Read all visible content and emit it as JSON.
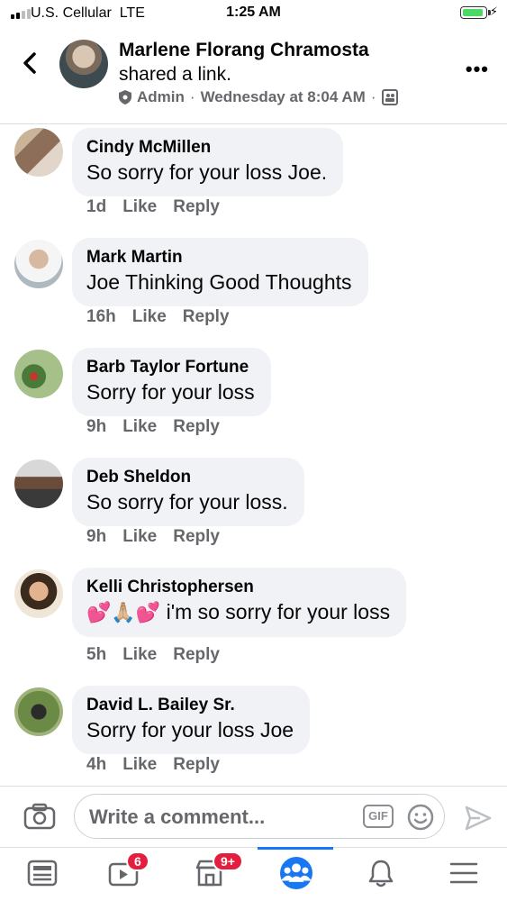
{
  "status_bar": {
    "carrier": "U.S. Cellular",
    "network": "LTE",
    "time": "1:25 AM"
  },
  "header": {
    "poster_name": "Marlene Florang Chramosta",
    "action": "shared a link.",
    "role": "Admin",
    "separator": "·",
    "timestamp": "Wednesday at 8:04 AM"
  },
  "comments": [
    {
      "name": "Cindy McMillen",
      "text": "So sorry for your loss Joe.",
      "time": "1d",
      "like": "Like",
      "reply": "Reply"
    },
    {
      "name": "Mark Martin",
      "text": "Joe Thinking Good Thoughts",
      "time": "16h",
      "like": "Like",
      "reply": "Reply"
    },
    {
      "name": "Barb Taylor Fortune",
      "text": "Sorry for your loss",
      "time": "9h",
      "like": "Like",
      "reply": "Reply"
    },
    {
      "name": "Deb Sheldon",
      "text": "So sorry for your loss.",
      "time": "9h",
      "like": "Like",
      "reply": "Reply"
    },
    {
      "name": "Kelli Christophersen",
      "emoji": "💕🙏🏼💕",
      "text": "i'm so sorry for your loss",
      "time": "5h",
      "like": "Like",
      "reply": "Reply"
    },
    {
      "name": "David L. Bailey Sr.",
      "text": "Sorry for your loss Joe",
      "time": "4h",
      "like": "Like",
      "reply": "Reply"
    }
  ],
  "composer": {
    "placeholder": "Write a comment...",
    "gif_label": "GIF"
  },
  "tabbar": {
    "watch_badge": "6",
    "marketplace_badge": "9+"
  },
  "colors": {
    "accent": "#1877f2",
    "badge": "#e41e3f",
    "bubble": "#f0f2f5",
    "secondary_text": "#65676b"
  }
}
